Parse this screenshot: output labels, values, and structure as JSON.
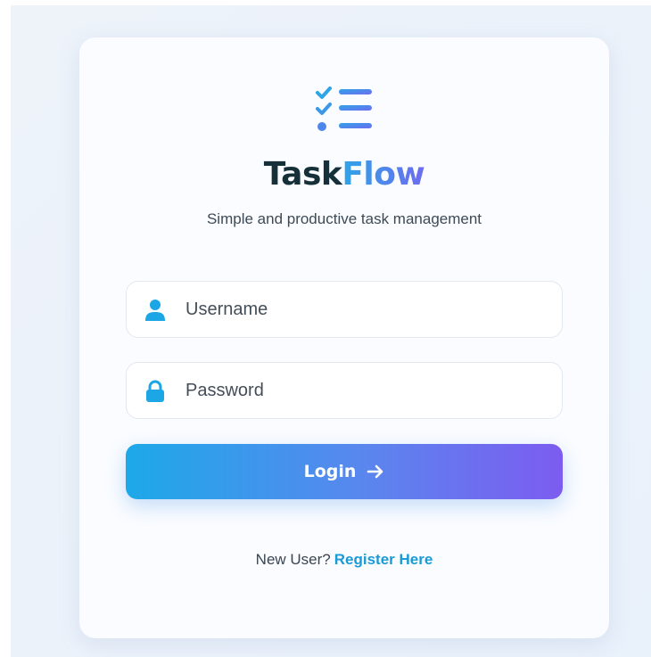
{
  "brand": {
    "title_part1": "Task",
    "title_part2": "Flow",
    "tagline": "Simple and productive task management",
    "logo_icon": "task-list-check-icon"
  },
  "form": {
    "username": {
      "placeholder": "Username",
      "value": "",
      "icon": "user-icon"
    },
    "password": {
      "placeholder": "Password",
      "value": "",
      "icon": "lock-icon"
    },
    "login_label": "Login",
    "login_icon": "arrow-right-icon"
  },
  "footer": {
    "prompt": "New User?",
    "register_link": "Register Here"
  },
  "colors": {
    "accent_start": "#1da9e9",
    "accent_end": "#7c5cf0",
    "link": "#1a9ad6",
    "title_dark": "#16303a"
  }
}
